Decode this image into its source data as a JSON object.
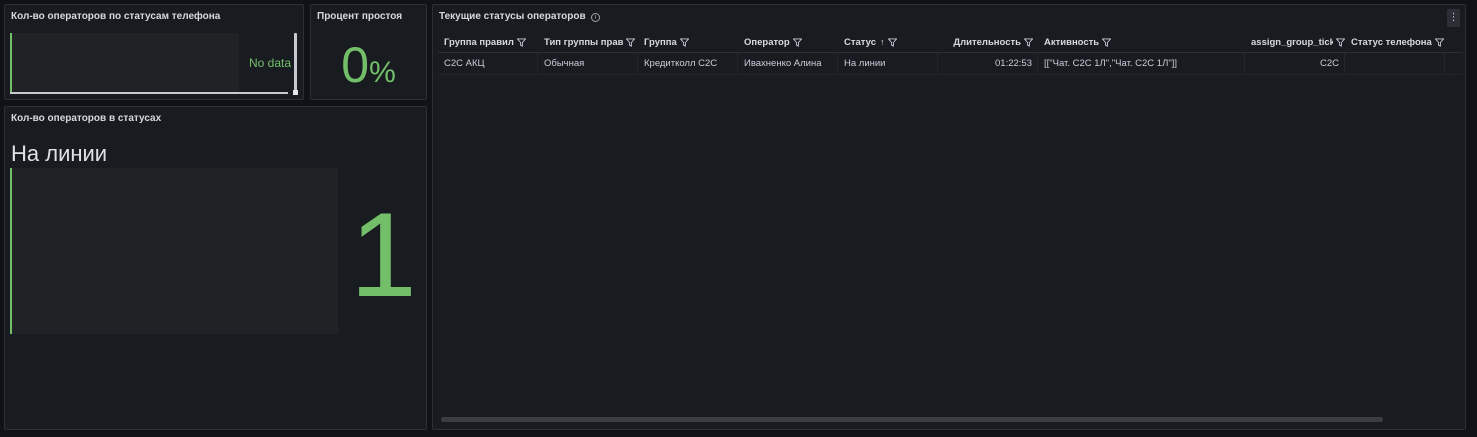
{
  "panels": {
    "phone_status_count": {
      "title": "Кол-во операторов по статусам телефона",
      "empty_text": "No data"
    },
    "idle_percent": {
      "title": "Процент простоя",
      "value": "0",
      "unit": "%"
    },
    "operators_in_status": {
      "title": "Кол-во операторов в статусах",
      "status_label": "На линии",
      "value": "1"
    },
    "current_statuses": {
      "title": "Текущие статусы операторов",
      "columns": [
        {
          "label": "Группа правил",
          "filter": true
        },
        {
          "label": "Тип группы прав",
          "filter": true
        },
        {
          "label": "Группа",
          "filter": true
        },
        {
          "label": "Оператор",
          "filter": true
        },
        {
          "label": "Статус",
          "filter": true,
          "sort": "↑"
        },
        {
          "label": "Длительность",
          "filter": true
        },
        {
          "label": "Активность",
          "filter": true
        },
        {
          "label": "assign_group_ticket",
          "filter": true
        },
        {
          "label": "Статус телефона",
          "filter": true
        }
      ],
      "rows": [
        [
          "C2C АКЦ",
          "Обычная",
          "Кредитколл C2C",
          "Ивахненко Алина",
          "На линии",
          "01:22:53",
          "[[\"Чат. C2C 1Л\",\"Чат. C2C 1Л\"]]",
          "C2C",
          ""
        ]
      ]
    }
  },
  "colors": {
    "accent_green": "#73bf69",
    "panel_bg": "#181b1f",
    "page_bg": "#111217"
  },
  "icons": {
    "filter": "filter-icon",
    "info": "info-icon",
    "menu": "kebab-menu-icon"
  }
}
